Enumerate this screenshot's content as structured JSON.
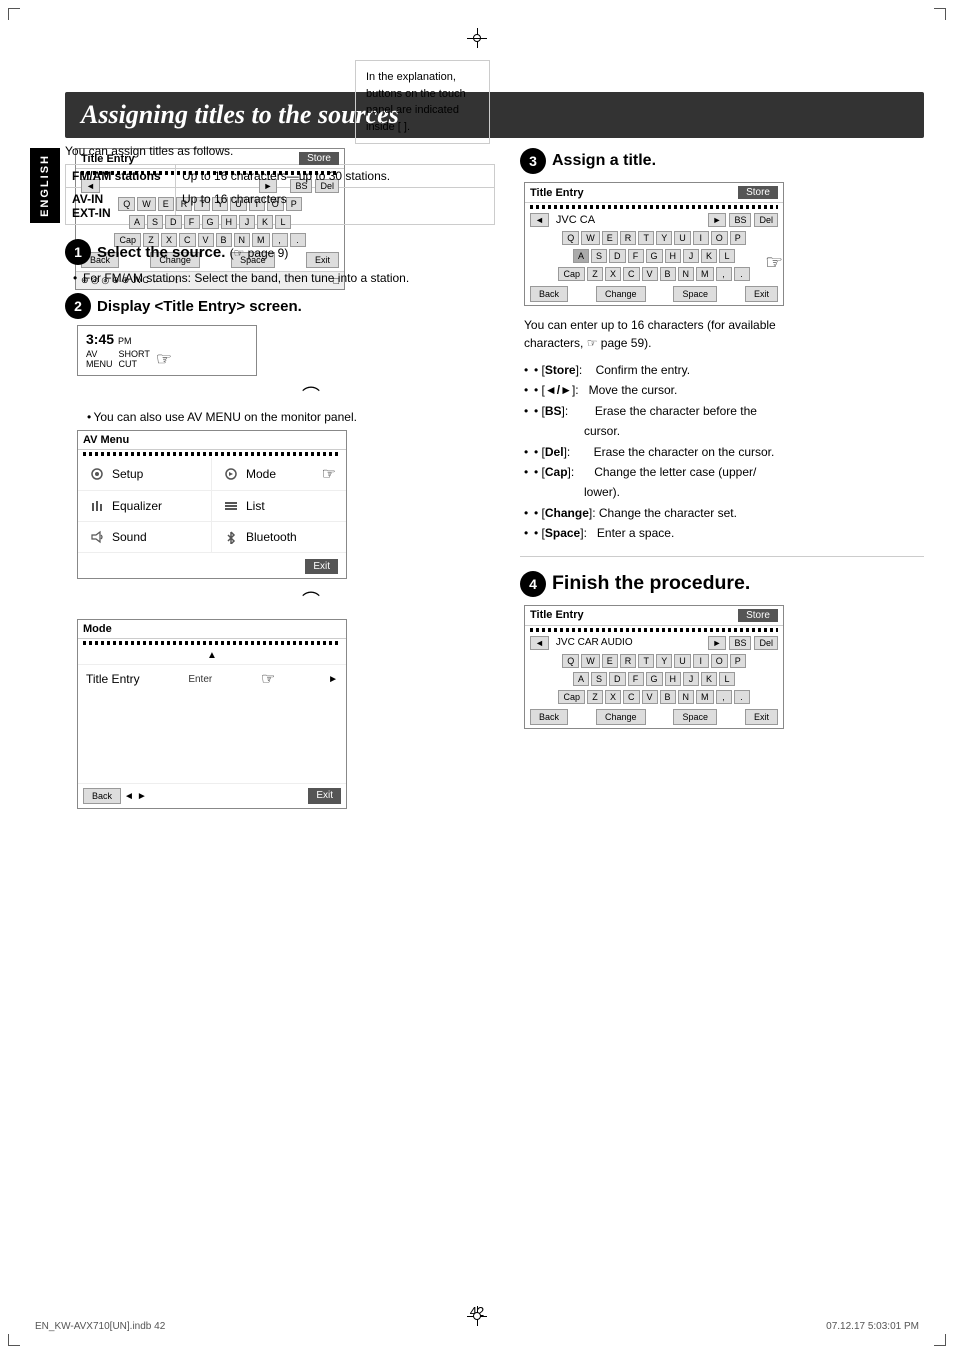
{
  "page": {
    "title": "Assigning titles to the sources",
    "page_number": "42",
    "footer_left": "EN_KW-AVX710[UN].indb   42",
    "footer_right": "07.12.17   5:03:01 PM"
  },
  "sidebar": {
    "label": "ENGLISH"
  },
  "note": {
    "text": "In the explanation, buttons on the touch panel are indicated inside [     ]."
  },
  "table": {
    "rows": [
      {
        "key": "FM/AM stations",
        "value": "Up to 16 characters—up to 30 stations."
      },
      {
        "key": "AV-IN\nEXT-IN",
        "value": "Up to 16 characters"
      }
    ]
  },
  "steps": [
    {
      "number": "1",
      "title": "Select the source.",
      "subtitle": "(☞ page 9)",
      "bullets": [
        "For FM/AM stations: Select the band, then tune into a station."
      ]
    },
    {
      "number": "2",
      "title": "Display <Title Entry> screen.",
      "bullets": [
        "You can also use AV MENU on the monitor panel."
      ],
      "time": "3:45",
      "time_pm": "PM"
    },
    {
      "number": "3",
      "title": "Assign a title.",
      "intro": "You can enter up to 16 characters (for available characters, ☞ page 59).",
      "bullets": [
        "[Store]:    Confirm the entry.",
        "[◄/►]:   Move the cursor.",
        "[BS]:        Erase the character before the cursor.",
        "[Del]:       Erase the character on the cursor.",
        "[Cap]:      Change the letter case (upper/lower).",
        "[Change]: Change the character set.",
        "[Space]:   Enter a space."
      ]
    },
    {
      "number": "4",
      "title": "Finish the procedure."
    }
  ],
  "av_menu": {
    "title": "AV Menu",
    "items": [
      {
        "icon": "setup",
        "label": "Setup"
      },
      {
        "icon": "mode",
        "label": "Mode"
      },
      {
        "icon": "equalizer",
        "label": "Equalizer"
      },
      {
        "icon": "list",
        "label": "List"
      },
      {
        "icon": "sound",
        "label": "Sound"
      },
      {
        "icon": "bluetooth",
        "label": "Bluetooth"
      }
    ],
    "exit_label": "Exit"
  },
  "mode_menu": {
    "title": "Mode",
    "item": "Title Entry",
    "enter_label": "Enter",
    "back_label": "Back",
    "exit_label": "Exit"
  },
  "touch_panels": {
    "title_entry_blank": {
      "title": "Title Entry",
      "store": "Store",
      "bs": "BS",
      "del": "Del",
      "keys_row1": [
        "Q",
        "W",
        "E",
        "R",
        "T",
        "Y",
        "U",
        "I",
        "O",
        "P"
      ],
      "keys_row2": [
        "A",
        "S",
        "D",
        "F",
        "G",
        "H",
        "J",
        "K",
        "L"
      ],
      "keys_row3": [
        "Cap",
        "Z",
        "X",
        "C",
        "V",
        "B",
        "N",
        "M",
        ",",
        "."
      ],
      "back": "Back",
      "change": "Change",
      "space": "Space",
      "exit": "Exit"
    },
    "title_entry_jvc_ca": {
      "title": "Title Entry",
      "store": "Store",
      "input": "JVC CA",
      "bs": "BS",
      "del": "Del"
    },
    "title_entry_jvc_car": {
      "title": "Title Entry",
      "store": "Store",
      "input": "JVC CAR AUDIO",
      "bs": "BS",
      "del": "Del"
    }
  }
}
